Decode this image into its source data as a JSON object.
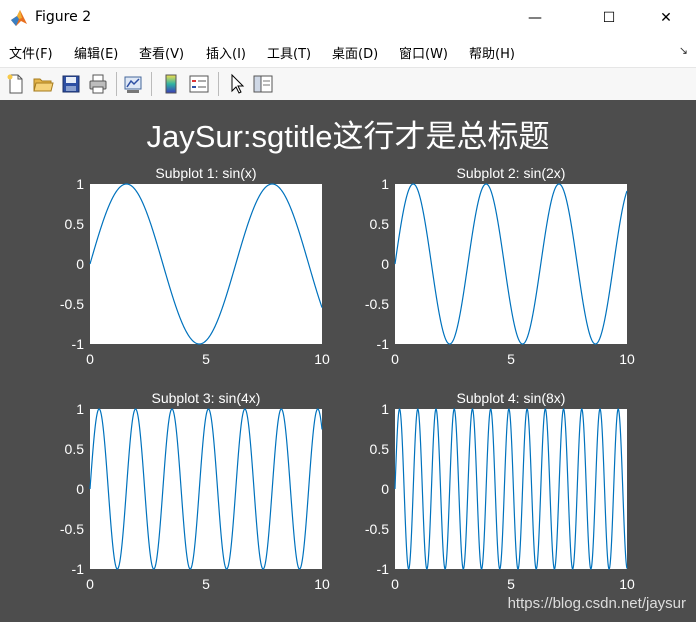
{
  "window": {
    "title": "Figure 2",
    "minimize_glyph": "—",
    "maximize_glyph": "☐",
    "close_glyph": "✕"
  },
  "menu": [
    {
      "label": "文件(F)"
    },
    {
      "label": "编辑(E)"
    },
    {
      "label": "查看(V)"
    },
    {
      "label": "插入(I)"
    },
    {
      "label": "工具(T)"
    },
    {
      "label": "桌面(D)"
    },
    {
      "label": "窗口(W)"
    },
    {
      "label": "帮助(H)"
    }
  ],
  "toolbar": [
    "new-file-icon",
    "open-folder-icon",
    "save-icon",
    "print-icon",
    "link-plot-icon",
    "insert-colorbar-icon",
    "insert-legend-icon",
    "pointer-icon",
    "plot-browser-icon"
  ],
  "figure": {
    "sgtitle": "JaySur:sgtitle这行才是总标题",
    "background": "#4d4d4d",
    "line_color": "#0072bd",
    "watermark": "https://blog.csdn.net/jaysur"
  },
  "chart_data": [
    {
      "type": "line",
      "title": "Subplot 1: sin(x)",
      "function": "sin(x)",
      "frequency": 1,
      "xlim": [
        0,
        10
      ],
      "ylim": [
        -1,
        1
      ],
      "xticks": [
        "0",
        "5",
        "10"
      ],
      "yticks": [
        "1",
        "0.5",
        "0",
        "-0.5",
        "-1"
      ],
      "grid": false
    },
    {
      "type": "line",
      "title": "Subplot 2: sin(2x)",
      "function": "sin(2x)",
      "frequency": 2,
      "xlim": [
        0,
        10
      ],
      "ylim": [
        -1,
        1
      ],
      "xticks": [
        "0",
        "5",
        "10"
      ],
      "yticks": [
        "1",
        "0.5",
        "0",
        "-0.5",
        "-1"
      ],
      "grid": false
    },
    {
      "type": "line",
      "title": "Subplot 3: sin(4x)",
      "function": "sin(4x)",
      "frequency": 4,
      "xlim": [
        0,
        10
      ],
      "ylim": [
        -1,
        1
      ],
      "xticks": [
        "0",
        "5",
        "10"
      ],
      "yticks": [
        "1",
        "0.5",
        "0",
        "-0.5",
        "-1"
      ],
      "grid": false
    },
    {
      "type": "line",
      "title": "Subplot 4: sin(8x)",
      "function": "sin(8x)",
      "frequency": 8,
      "xlim": [
        0,
        10
      ],
      "ylim": [
        -1,
        1
      ],
      "xticks": [
        "0",
        "5",
        "10"
      ],
      "yticks": [
        "1",
        "0.5",
        "0",
        "-0.5",
        "-1"
      ],
      "grid": false
    }
  ]
}
